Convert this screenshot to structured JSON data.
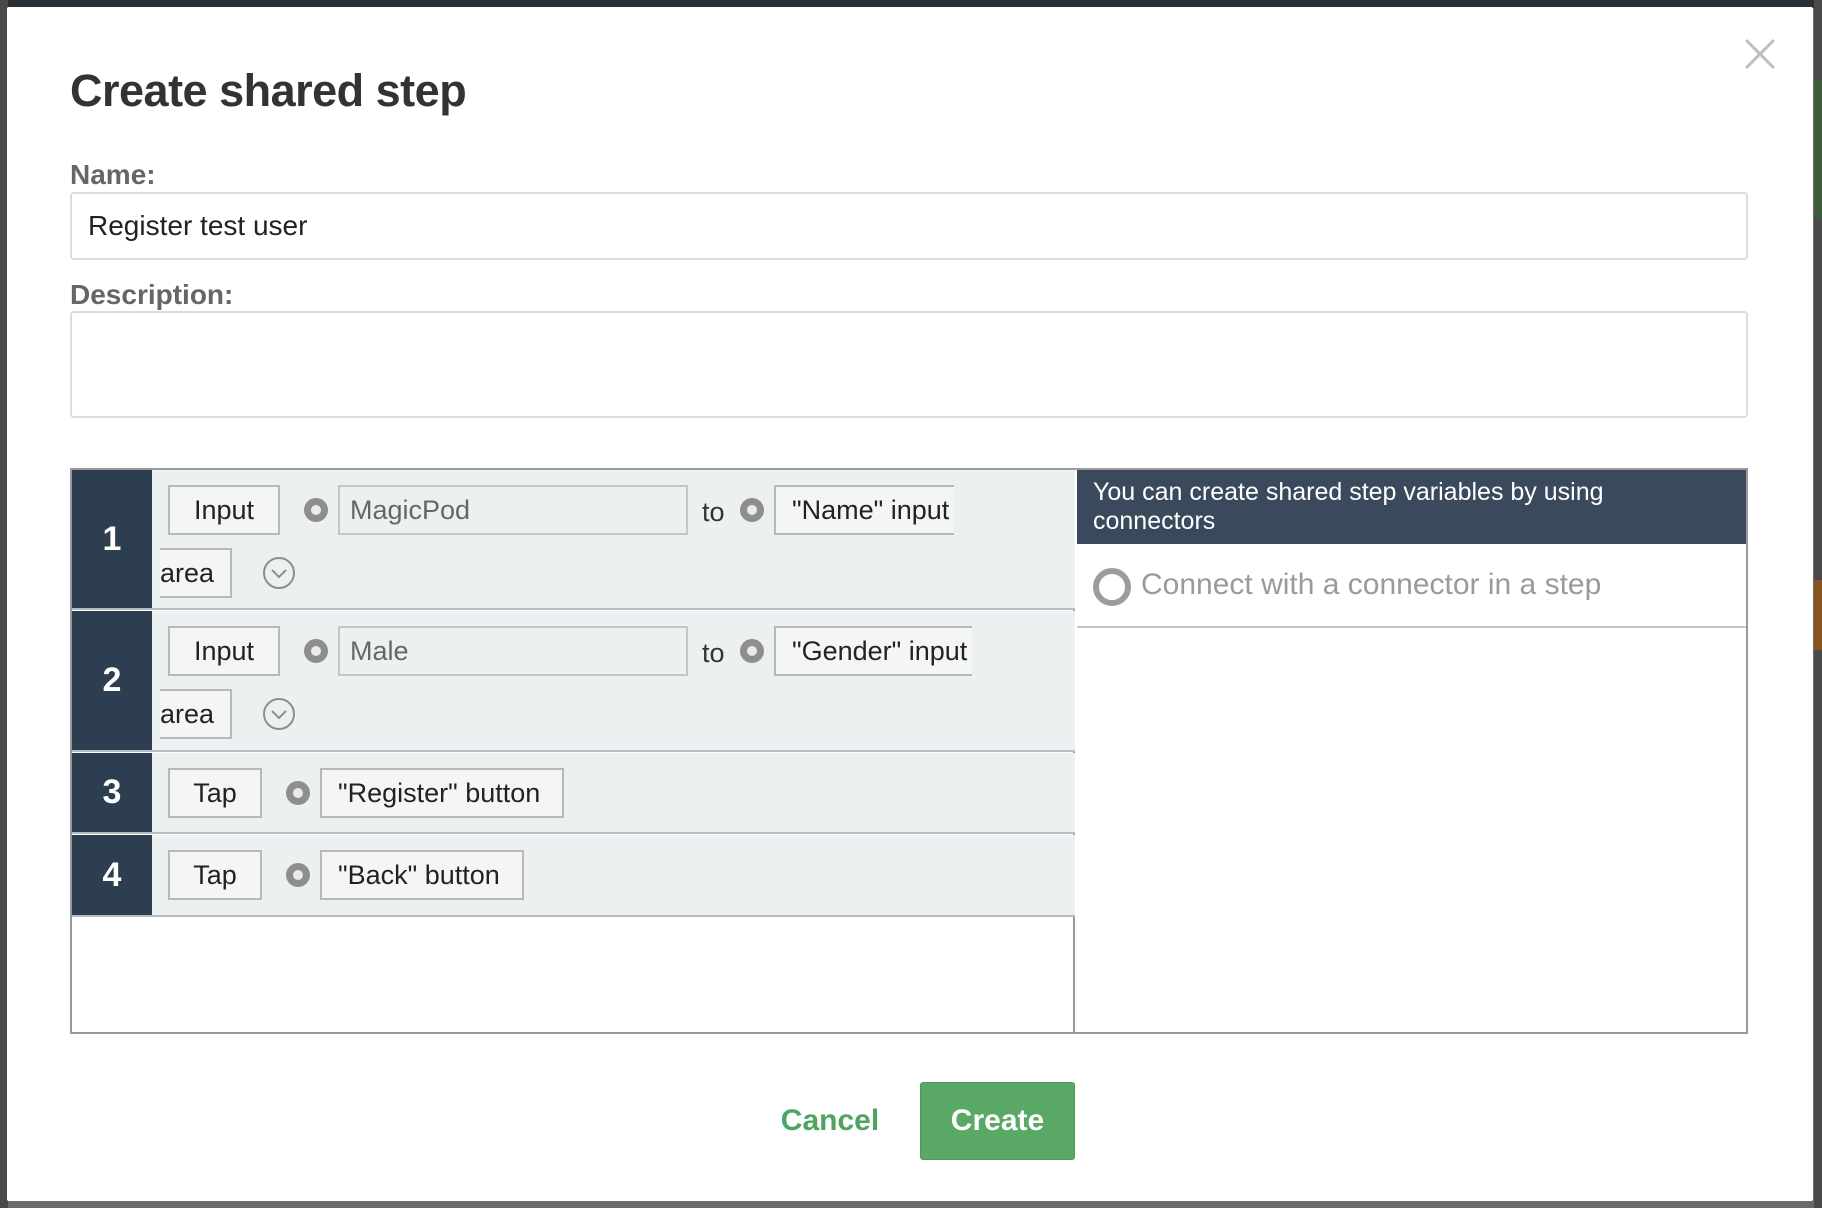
{
  "dialog": {
    "title": "Create shared step",
    "name_label": "Name:",
    "name_value": "Register test user",
    "description_label": "Description:",
    "description_value": "",
    "cancel_label": "Cancel",
    "create_label": "Create"
  },
  "steps": [
    {
      "number": "1",
      "command": "Input",
      "value": "MagicPod",
      "to": "to",
      "target_part1": "\"Name\" input",
      "target_part2": "area"
    },
    {
      "number": "2",
      "command": "Input",
      "value": "Male",
      "to": "to",
      "target_part1": "\"Gender\" input",
      "target_part2": "area"
    },
    {
      "number": "3",
      "command": "Tap",
      "target": "\"Register\" button"
    },
    {
      "number": "4",
      "command": "Tap",
      "target": "\"Back\" button"
    }
  ],
  "variables_panel": {
    "header": "You can create shared step variables by using connectors",
    "placeholder": "Connect with a connector in a step"
  },
  "colors": {
    "step_number_bg": "#2d3e50",
    "panel_header_bg": "#3a4a5c",
    "create_button_bg": "#5aa866",
    "cancel_text": "#4ea460"
  },
  "icons": {
    "close": "close-icon",
    "expand": "chevron-down-circle-icon",
    "connector": "connector-dot-icon"
  }
}
